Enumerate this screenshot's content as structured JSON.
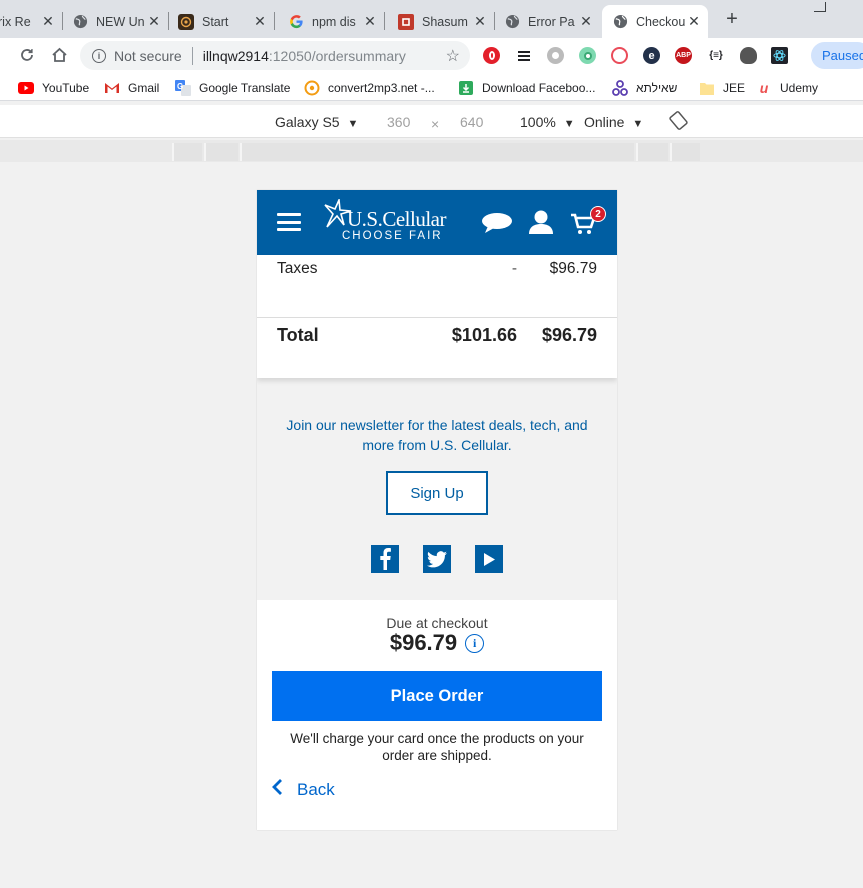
{
  "browser": {
    "tabs": [
      {
        "title": "rix Re",
        "icon": "globe",
        "active": false
      },
      {
        "title": "NEW Un",
        "icon": "globe",
        "active": false
      },
      {
        "title": "Start",
        "icon": "start",
        "active": false
      },
      {
        "title": "npm dis",
        "icon": "google",
        "active": false
      },
      {
        "title": "Shasum",
        "icon": "shasum",
        "active": false
      },
      {
        "title": "Error Pa",
        "icon": "globe",
        "active": false
      },
      {
        "title": "Checkou",
        "icon": "globe",
        "active": true
      }
    ],
    "close_glyph": "✕",
    "new_tab_glyph": "+",
    "omnibox": {
      "security_label": "Not secure",
      "host": "illnqw2914",
      "path": ":12050/ordersummary"
    },
    "profile_status": "Paused",
    "bookmarks": [
      {
        "label": "YouTube",
        "icon": "youtube"
      },
      {
        "label": "Gmail",
        "icon": "gmail"
      },
      {
        "label": "Google Translate",
        "icon": "translate"
      },
      {
        "label": "convert2mp3.net -...",
        "icon": "convert"
      },
      {
        "label": "Download Faceboo...",
        "icon": "download"
      },
      {
        "label": "שאילתא",
        "icon": "network"
      },
      {
        "label": "JEE",
        "icon": "folder"
      },
      {
        "label": "Udemy",
        "icon": "udemy"
      }
    ]
  },
  "device_toolbar": {
    "device": "Galaxy S5",
    "width": "360",
    "times": "×",
    "height": "640",
    "zoom": "100%",
    "network": "Online"
  },
  "site": {
    "brand": "U.S.Cellular",
    "tagline": "CHOOSE FAIR",
    "cart_count": "2",
    "summary": {
      "taxes_label": "Taxes",
      "taxes_col1": "-",
      "taxes_col2": "$96.79",
      "total_label": "Total",
      "total_col1": "$101.66",
      "total_col2": "$96.79"
    },
    "newsletter": {
      "text": "Join our newsletter for the latest deals, tech, and more from U.S. Cellular.",
      "signup_label": "Sign Up",
      "social": [
        "facebook-icon",
        "twitter-icon",
        "youtube-icon"
      ]
    },
    "checkout": {
      "due_label": "Due at checkout",
      "due_amount": "$96.79",
      "info_glyph": "i",
      "place_order_label": "Place Order",
      "charge_note": "We'll charge your card once the products on your order are shipped.",
      "back_label": "Back"
    }
  },
  "colors": {
    "brand_blue": "#005ea2",
    "cta_blue": "#0070f0",
    "badge_red": "#d71e2b"
  }
}
